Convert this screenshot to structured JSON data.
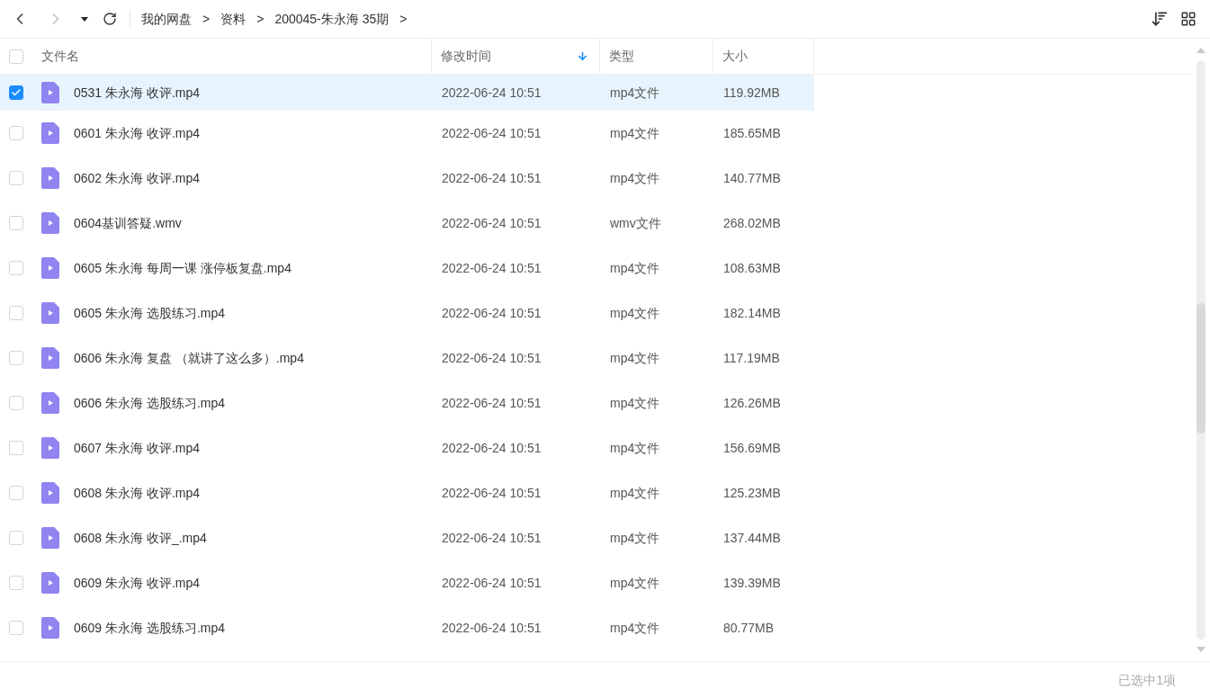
{
  "breadcrumb": [
    "我的网盘",
    "资料",
    "200045-朱永海 35期"
  ],
  "breadcrumb_separator": ">",
  "table": {
    "select_all_checked": false,
    "columns": [
      {
        "label": "文件名",
        "sorted": false
      },
      {
        "label": "修改时间",
        "sorted": true
      },
      {
        "label": "类型",
        "sorted": false
      },
      {
        "label": "大小",
        "sorted": false
      }
    ],
    "rows": [
      {
        "name": "0531 朱永海 收评.mp4",
        "modified": "2022-06-24 10:51",
        "type": "mp4文件",
        "size": "119.92MB",
        "selected": true
      },
      {
        "name": "0601 朱永海 收评.mp4",
        "modified": "2022-06-24 10:51",
        "type": "mp4文件",
        "size": "185.65MB",
        "selected": false
      },
      {
        "name": "0602 朱永海 收评.mp4",
        "modified": "2022-06-24 10:51",
        "type": "mp4文件",
        "size": "140.77MB",
        "selected": false
      },
      {
        "name": "0604基训答疑.wmv",
        "modified": "2022-06-24 10:51",
        "type": "wmv文件",
        "size": "268.02MB",
        "selected": false
      },
      {
        "name": "0605 朱永海 每周一课 涨停板复盘.mp4",
        "modified": "2022-06-24 10:51",
        "type": "mp4文件",
        "size": "108.63MB",
        "selected": false
      },
      {
        "name": "0605 朱永海 选股练习.mp4",
        "modified": "2022-06-24 10:51",
        "type": "mp4文件",
        "size": "182.14MB",
        "selected": false
      },
      {
        "name": "0606 朱永海 复盘 （就讲了这么多）.mp4",
        "modified": "2022-06-24 10:51",
        "type": "mp4文件",
        "size": "117.19MB",
        "selected": false
      },
      {
        "name": "0606 朱永海 选股练习.mp4",
        "modified": "2022-06-24 10:51",
        "type": "mp4文件",
        "size": "126.26MB",
        "selected": false
      },
      {
        "name": "0607 朱永海 收评.mp4",
        "modified": "2022-06-24 10:51",
        "type": "mp4文件",
        "size": "156.69MB",
        "selected": false
      },
      {
        "name": "0608 朱永海 收评.mp4",
        "modified": "2022-06-24 10:51",
        "type": "mp4文件",
        "size": "125.23MB",
        "selected": false
      },
      {
        "name": "0608 朱永海 收评_.mp4",
        "modified": "2022-06-24 10:51",
        "type": "mp4文件",
        "size": "137.44MB",
        "selected": false
      },
      {
        "name": "0609 朱永海 收评.mp4",
        "modified": "2022-06-24 10:51",
        "type": "mp4文件",
        "size": "139.39MB",
        "selected": false
      },
      {
        "name": "0609 朱永海 选股练习.mp4",
        "modified": "2022-06-24 10:51",
        "type": "mp4文件",
        "size": "80.77MB",
        "selected": false
      }
    ]
  },
  "status_bar": "已选中1项"
}
